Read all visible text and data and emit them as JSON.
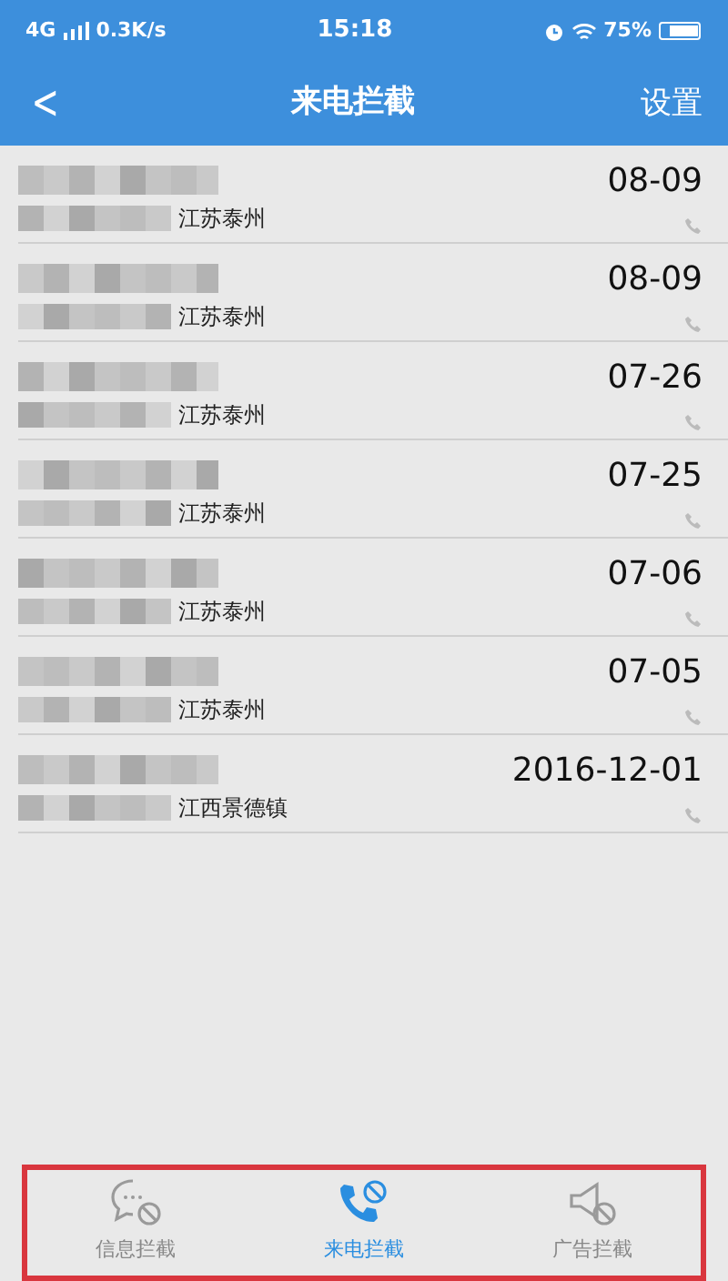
{
  "status_bar": {
    "network": "4G",
    "speed": "0.3K/s",
    "time": "15:18",
    "battery": "75%"
  },
  "header": {
    "back": "<",
    "title": "来电拦截",
    "action": "设置"
  },
  "calls": [
    {
      "location": "江苏泰州",
      "date": "08-09"
    },
    {
      "location": "江苏泰州",
      "date": "08-09"
    },
    {
      "location": "江苏泰州",
      "date": "07-26"
    },
    {
      "location": "江苏泰州",
      "date": "07-25"
    },
    {
      "location": "江苏泰州",
      "date": "07-06"
    },
    {
      "location": "江苏泰州",
      "date": "07-05"
    },
    {
      "location": "江西景德镇",
      "date": "2016-12-01"
    }
  ],
  "tabs": [
    {
      "kind": "message",
      "label": "信息拦截",
      "selected": false
    },
    {
      "kind": "phone",
      "label": "来电拦截",
      "selected": true
    },
    {
      "kind": "ad",
      "label": "广告拦截",
      "selected": false
    }
  ]
}
